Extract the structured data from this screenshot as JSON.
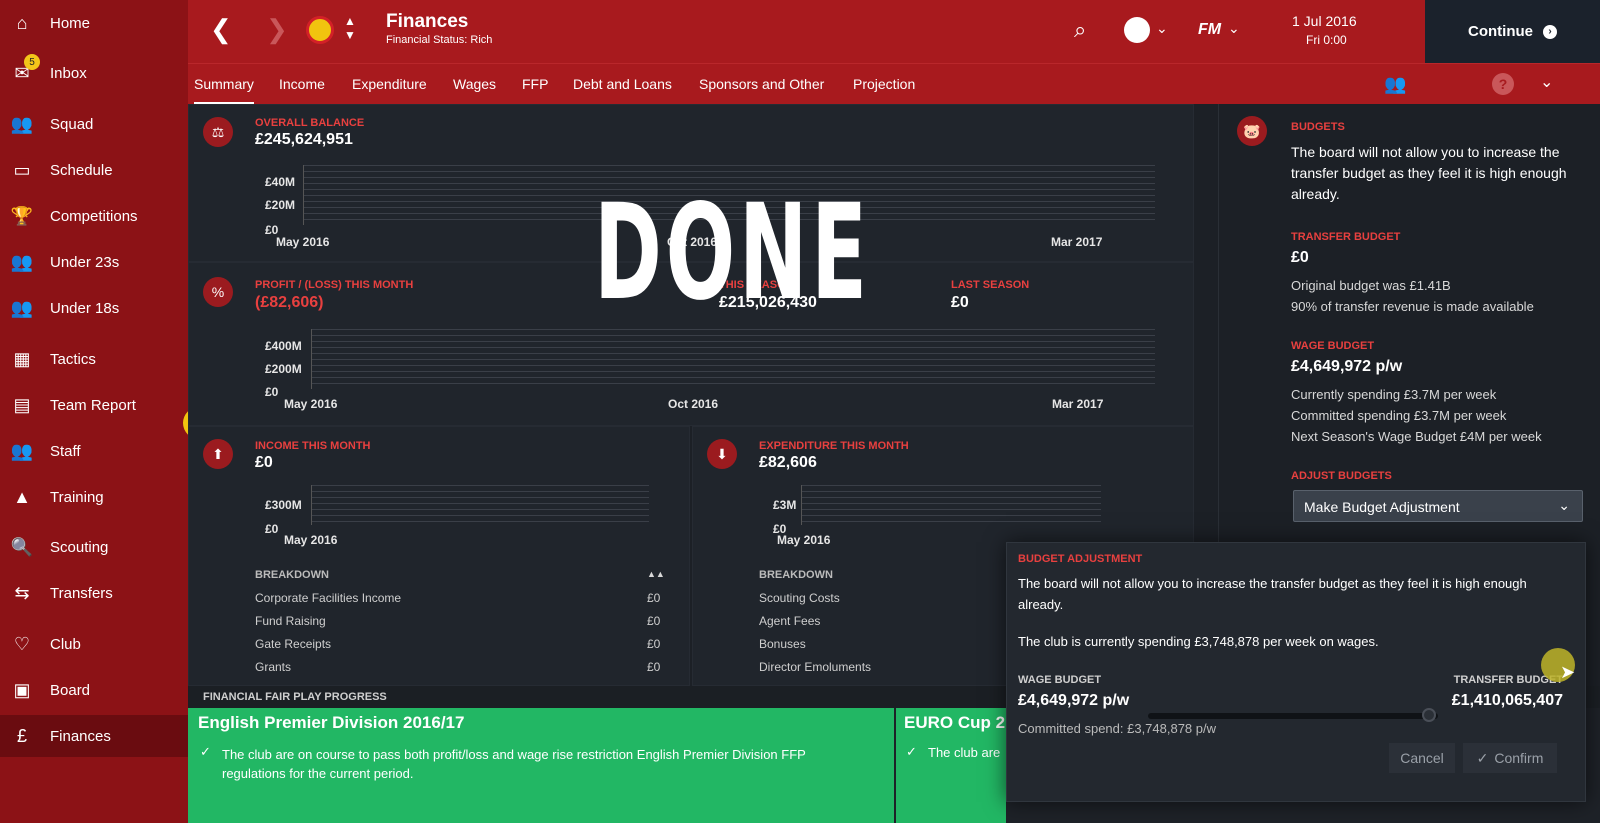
{
  "sidebar": {
    "items": [
      {
        "label": "Home",
        "icon": "home-icon",
        "glyph": "⌂"
      },
      {
        "label": "Inbox",
        "icon": "inbox-icon",
        "glyph": "✉",
        "badge": "5"
      },
      {
        "label": "Squad",
        "icon": "squad-icon",
        "glyph": "👥"
      },
      {
        "label": "Schedule",
        "icon": "schedule-icon",
        "glyph": "▭"
      },
      {
        "label": "Competitions",
        "icon": "trophy-icon",
        "glyph": "🏆"
      },
      {
        "label": "Under 23s",
        "icon": "under23-icon",
        "glyph": "👥"
      },
      {
        "label": "Under 18s",
        "icon": "under18-icon",
        "glyph": "👥"
      },
      {
        "label": "Tactics",
        "icon": "tactics-icon",
        "glyph": "▦"
      },
      {
        "label": "Team Report",
        "icon": "report-icon",
        "glyph": "▤"
      },
      {
        "label": "Staff",
        "icon": "staff-icon",
        "glyph": "👥"
      },
      {
        "label": "Training",
        "icon": "training-icon",
        "glyph": "▲"
      },
      {
        "label": "Scouting",
        "icon": "scouting-icon",
        "glyph": "🔍"
      },
      {
        "label": "Transfers",
        "icon": "transfers-icon",
        "glyph": "⇆"
      },
      {
        "label": "Club",
        "icon": "club-icon",
        "glyph": "♡"
      },
      {
        "label": "Board",
        "icon": "board-icon",
        "glyph": "▣"
      },
      {
        "label": "Finances",
        "icon": "finances-icon",
        "glyph": "£"
      }
    ],
    "help": "?"
  },
  "header": {
    "title": "Finances",
    "subtitle": "Financial Status: Rich",
    "date": "1 Jul 2016",
    "time": "Fri 0:00",
    "continue": "Continue",
    "fm_label": "FM"
  },
  "tabs": [
    "Summary",
    "Income",
    "Expenditure",
    "Wages",
    "FFP",
    "Debt and Loans",
    "Sponsors and Other",
    "Projection"
  ],
  "overlay_text": "DONE",
  "overall": {
    "label": "OVERALL BALANCE",
    "value": "£245,624,951",
    "ticks": [
      "£40M",
      "£20M",
      "£0"
    ],
    "x_labels": [
      "May 2016",
      "Oct 2016",
      "Mar 2017"
    ]
  },
  "profit": {
    "label": "PROFIT / (LOSS) THIS MONTH",
    "value": "(£82,606)",
    "season_label": "THIS SEASON",
    "season_value": "£215,026,430",
    "last_label": "LAST SEASON",
    "last_value": "£0",
    "ticks": [
      "£400M",
      "£200M",
      "£0"
    ],
    "x_labels": [
      "May 2016",
      "Oct 2016",
      "Mar 2017"
    ]
  },
  "income": {
    "label": "INCOME THIS MONTH",
    "value": "£0",
    "ticks": [
      "£300M",
      "£0"
    ],
    "x_label": "May 2016",
    "breakdown_label": "BREAKDOWN",
    "rows": [
      {
        "name": "Corporate Facilities Income",
        "value": "£0"
      },
      {
        "name": "Fund Raising",
        "value": "£0"
      },
      {
        "name": "Gate Receipts",
        "value": "£0"
      },
      {
        "name": "Grants",
        "value": "£0"
      }
    ]
  },
  "expenditure": {
    "label": "EXPENDITURE THIS MONTH",
    "value": "£82,606",
    "ticks": [
      "£3M",
      "£0"
    ],
    "x_label": "May 2016",
    "breakdown_label": "BREAKDOWN",
    "rows": [
      "Scouting Costs",
      "Agent Fees",
      "Bonuses",
      "Director Emoluments"
    ]
  },
  "budgets": {
    "label": "BUDGETS",
    "text": "The board will not allow you to increase the transfer budget as they feel it is high enough already.",
    "transfer_label": "TRANSFER BUDGET",
    "transfer_value": "£0",
    "transfer_note1": "Original budget was £1.41B",
    "transfer_note2": "90% of transfer revenue is made available",
    "wage_label": "WAGE BUDGET",
    "wage_value": "£4,649,972 p/w",
    "wage_note1": "Currently spending £3.7M per week",
    "wage_note2": "Committed spending £3.7M per week",
    "wage_note3": "Next Season's Wage Budget £4M per week",
    "adjust_label": "ADJUST BUDGETS",
    "adjust_select": "Make Budget Adjustment"
  },
  "ffp": {
    "bar_label": "FINANCIAL FAIR PLAY PROGRESS",
    "card1_title": "English Premier Division 2016/17",
    "card1_text": "The club are on course to pass both profit/loss and wage rise restriction English Premier Division FFP regulations for the current period.",
    "card2_title": "EURO Cup 2",
    "card2_text": "The club are"
  },
  "popup": {
    "title": "BUDGET ADJUSTMENT",
    "text1": "The board will not allow you to increase the transfer budget as they feel it is high enough already.",
    "text2": "The club is currently spending £3,748,878 per week on wages.",
    "wage_label": "WAGE BUDGET",
    "wage_value": "£4,649,972 p/w",
    "transfer_label": "TRANSFER BUDGET",
    "transfer_value": "£1,410,065,407",
    "committed": "Committed spend: £3,748,878 p/w",
    "slider_position": 0.97,
    "cancel": "Cancel",
    "confirm": "Confirm"
  }
}
